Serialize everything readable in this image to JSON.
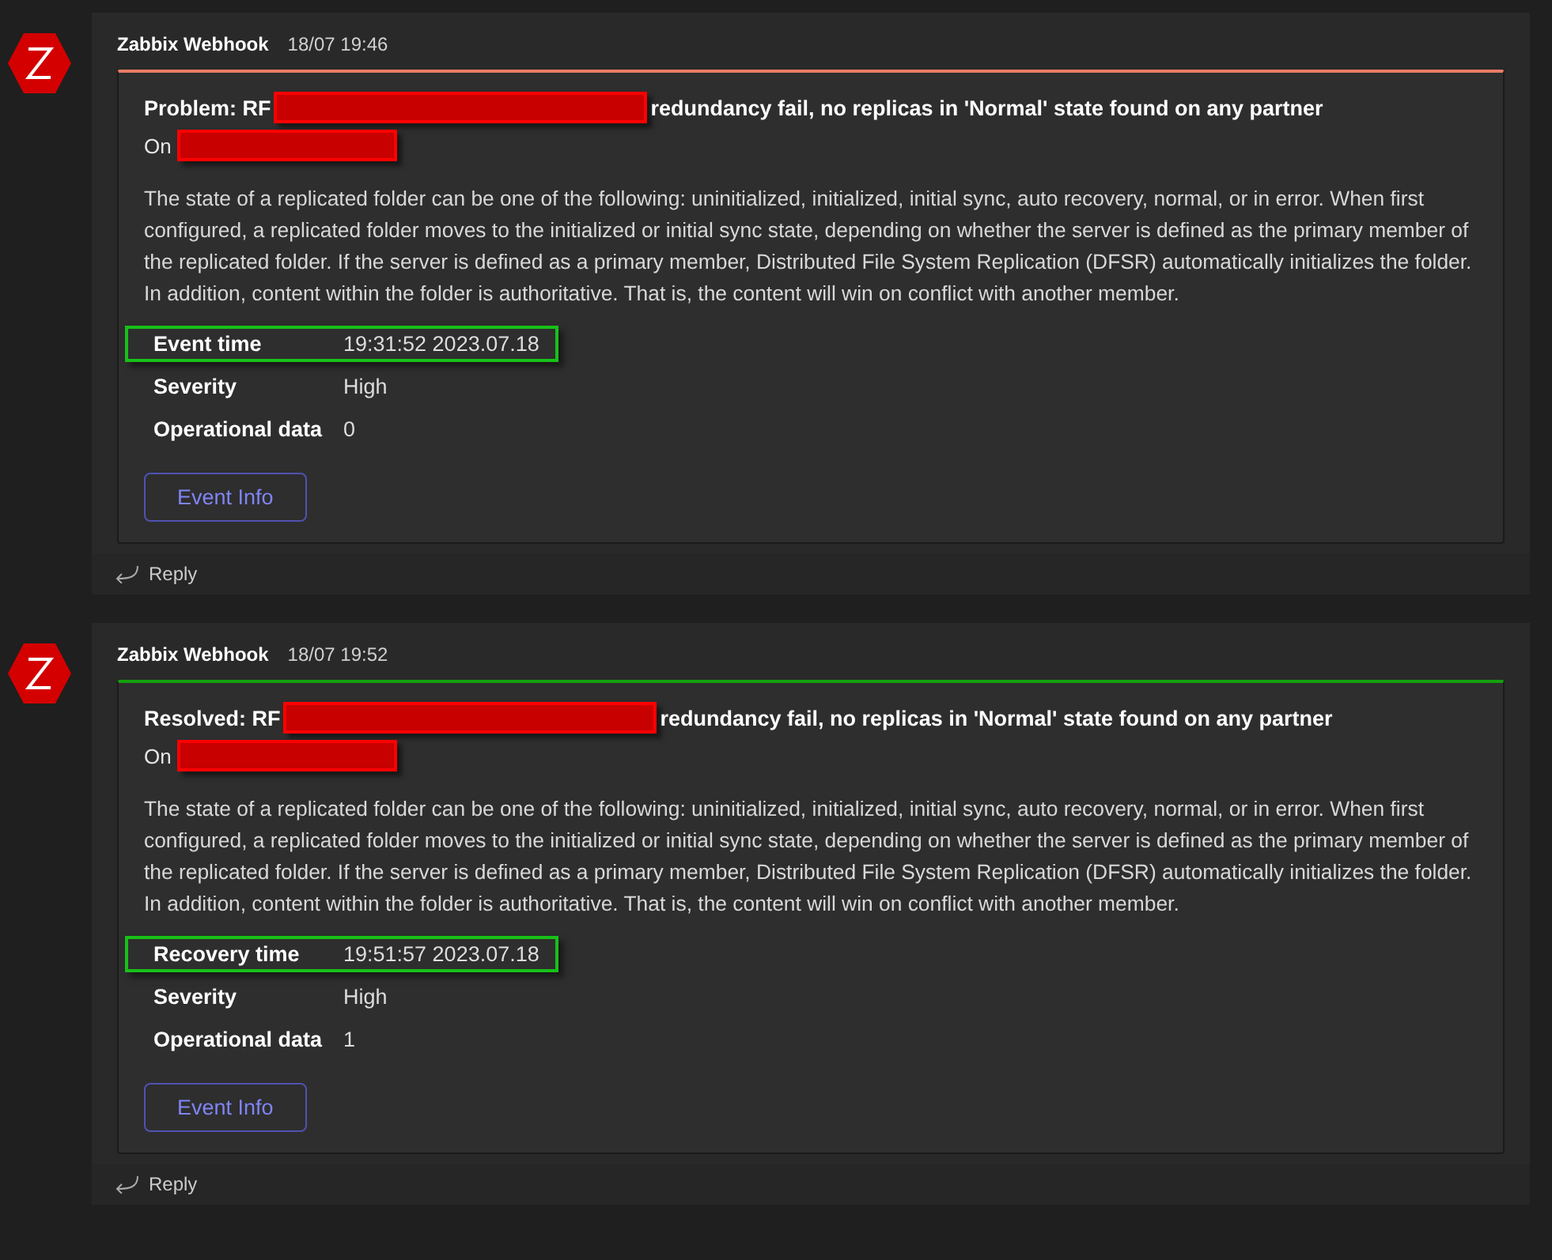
{
  "messages": [
    {
      "sender": "Zabbix Webhook",
      "time": "18/07 19:46",
      "color": "#e97c64",
      "card": {
        "title_prefix": "Problem: RF",
        "title_suffix": "redundancy fail, no replicas in 'Normal' state found on any partner",
        "on_label": "On",
        "description": "The state of a replicated folder can be one of the following: uninitialized, initialized, initial sync, auto recovery, normal, or in error. When first configured, a replicated folder moves to the initialized or initial sync state, depending on whether the server is defined as the primary member of the replicated folder. If the server is defined as a primary member, Distributed File System Replication (DFSR) automatically initializes the folder. In addition, content within the folder is authoritative. That is, the content will win on conflict with another member.",
        "facts": [
          {
            "label": "Event time",
            "value": "19:31:52 2023.07.18",
            "highlighted": true
          },
          {
            "label": "Severity",
            "value": "High",
            "highlighted": false
          },
          {
            "label": "Operational data",
            "value": "0",
            "highlighted": false
          }
        ],
        "button": "Event Info"
      },
      "reply": "Reply"
    },
    {
      "sender": "Zabbix Webhook",
      "time": "18/07 19:52",
      "color": "#13a10e",
      "card": {
        "title_prefix": "Resolved: RF",
        "title_suffix": "redundancy fail, no replicas in 'Normal' state found on any partner",
        "on_label": "On",
        "description": "The state of a replicated folder can be one of the following: uninitialized, initialized, initial sync, auto recovery, normal, or in error. When first configured, a replicated folder moves to the initialized or initial sync state, depending on whether the server is defined as the primary member of the replicated folder. If the server is defined as a primary member, Distributed File System Replication (DFSR) automatically initializes the folder. In addition, content within the folder is authoritative. That is, the content will win on conflict with another member.",
        "facts": [
          {
            "label": "Recovery time",
            "value": "19:51:57 2023.07.18",
            "highlighted": true
          },
          {
            "label": "Severity",
            "value": "High",
            "highlighted": false
          },
          {
            "label": "Operational data",
            "value": "1",
            "highlighted": false
          }
        ],
        "button": "Event Info"
      },
      "reply": "Reply"
    }
  ]
}
